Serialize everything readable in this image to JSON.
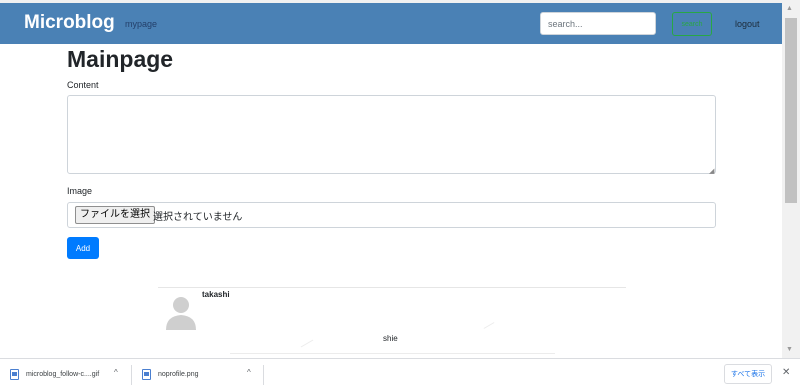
{
  "navbar": {
    "brand": "Microblog",
    "mypage_link": "mypage",
    "search_placeholder": "search...",
    "search_button": "search",
    "logout": "logout",
    "color": "#4a81b5"
  },
  "main": {
    "title": "Mainpage",
    "content_label": "Content",
    "image_label": "Image",
    "file_button": "ファイルを選択",
    "file_status": "選択されていません",
    "add_button": "Add"
  },
  "post": {
    "author": "takashi",
    "text": "shie",
    "avatar_icon": "person-silhouette-icon"
  },
  "downloads": {
    "items": [
      {
        "name": "microblog_follow-c....gif",
        "icon": "file-icon"
      },
      {
        "name": "noprofile.png",
        "icon": "file-icon"
      }
    ],
    "show_all": "すべて表示",
    "close_icon": "close-icon"
  },
  "colors": {
    "primary": "#007bff",
    "success": "#28a745"
  }
}
